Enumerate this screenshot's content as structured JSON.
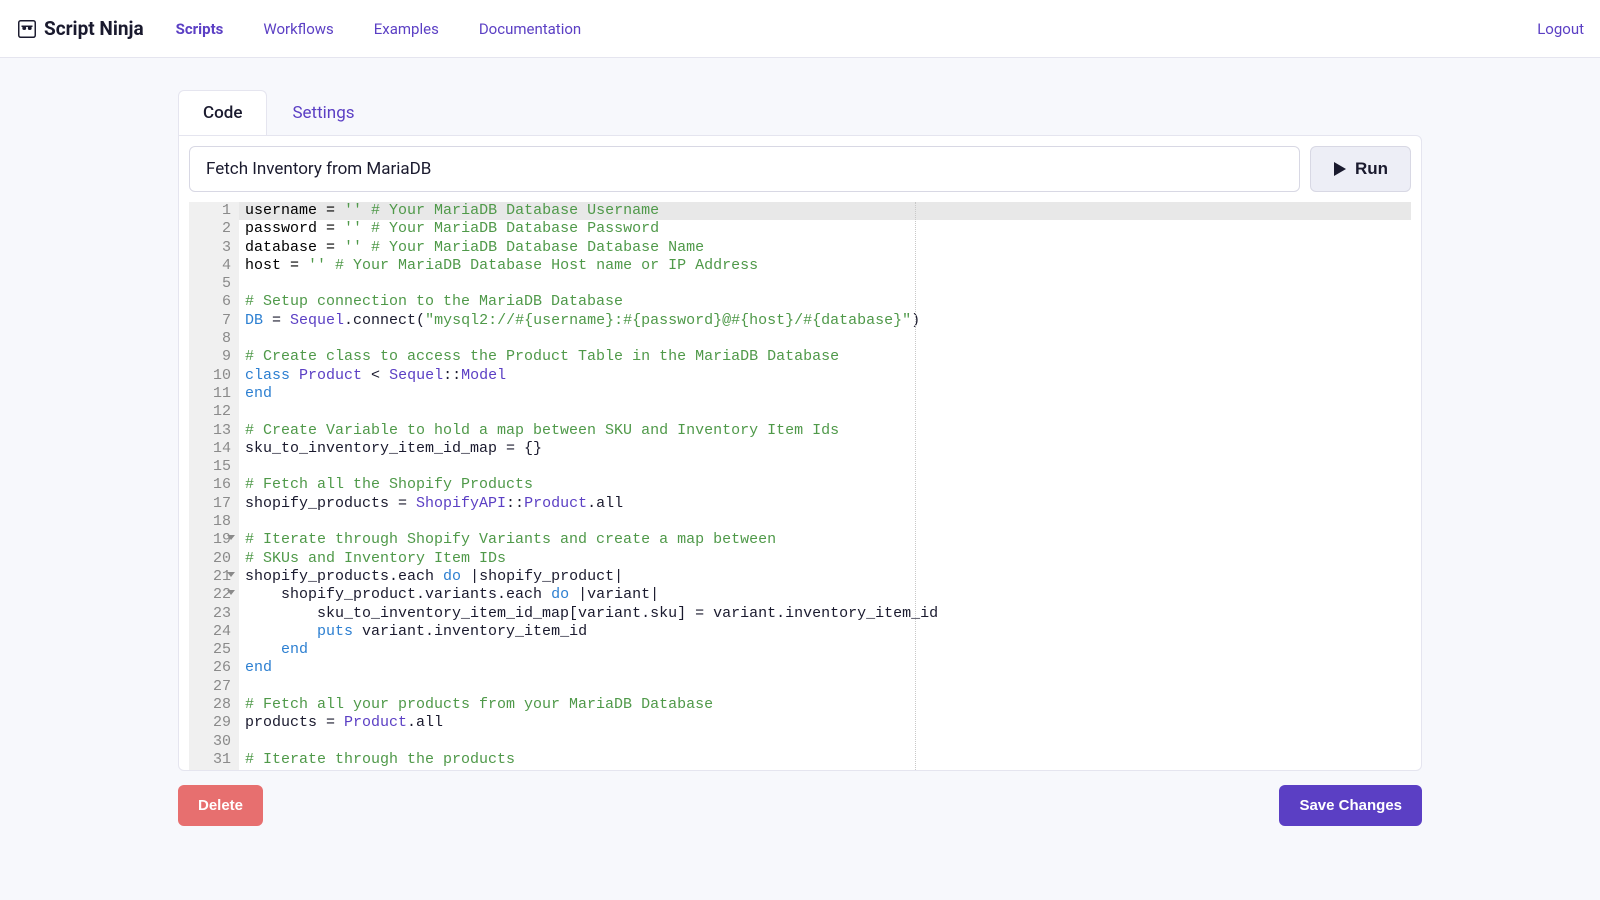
{
  "brand": "Script Ninja",
  "nav": {
    "scripts": "Scripts",
    "workflows": "Workflows",
    "examples": "Examples",
    "documentation": "Documentation",
    "logout": "Logout"
  },
  "tabs": {
    "code": "Code",
    "settings": "Settings"
  },
  "script_title": "Fetch Inventory from MariaDB",
  "run_label": "Run",
  "delete_label": "Delete",
  "save_label": "Save Changes",
  "code": {
    "l1": {
      "a": "username ",
      "b": "=",
      "c": " ''",
      "d": " # Your MariaDB Database Username"
    },
    "l2": {
      "a": "password ",
      "b": "=",
      "c": " ''",
      "d": " # Your MariaDB Database Password"
    },
    "l3": {
      "a": "database ",
      "b": "=",
      "c": " ''",
      "d": " # Your MariaDB Database Database Name"
    },
    "l4": {
      "a": "host ",
      "b": "=",
      "c": " ''",
      "d": " # Your MariaDB Database Host name or IP Address"
    },
    "l6": "# Setup connection to the MariaDB Database",
    "l7": {
      "a": "DB",
      "b": " = ",
      "c": "Sequel",
      "d": ".connect(",
      "e": "\"mysql2://#{username}:#{password}@#{host}/#{database}\"",
      "f": ")"
    },
    "l9": "# Create class to access the Product Table in the MariaDB Database",
    "l10": {
      "a": "class",
      "b": " ",
      "c": "Product",
      "d": " < ",
      "e": "Sequel",
      "f": "::",
      "g": "Model"
    },
    "l11": "end",
    "l13": "# Create Variable to hold a map between SKU and Inventory Item Ids",
    "l14": "sku_to_inventory_item_id_map = {}",
    "l16": "# Fetch all the Shopify Products",
    "l17": {
      "a": "shopify_products = ",
      "b": "ShopifyAPI",
      "c": "::",
      "d": "Product",
      "e": ".all"
    },
    "l19": "# Iterate through Shopify Variants and create a map between",
    "l20": "# SKUs and Inventory Item IDs",
    "l21": {
      "a": "shopify_products.each ",
      "b": "do",
      "c": " |shopify_product|"
    },
    "l22": {
      "a": "    shopify_product.variants.each ",
      "b": "do",
      "c": " |variant|"
    },
    "l23": "        sku_to_inventory_item_id_map[variant.sku] = variant.inventory_item_id",
    "l24": {
      "a": "        ",
      "b": "puts",
      "c": " variant.inventory_item_id"
    },
    "l25": {
      "a": "    ",
      "b": "end"
    },
    "l26": "end",
    "l28": "# Fetch all your products from your MariaDB Database",
    "l29": {
      "a": "products = ",
      "b": "Product",
      "c": ".all"
    },
    "l31": "# Iterate through the products"
  },
  "line_numbers": [
    "1",
    "2",
    "3",
    "4",
    "5",
    "6",
    "7",
    "8",
    "9",
    "10",
    "11",
    "12",
    "13",
    "14",
    "15",
    "16",
    "17",
    "18",
    "19",
    "20",
    "21",
    "22",
    "23",
    "24",
    "25",
    "26",
    "27",
    "28",
    "29",
    "30",
    "31"
  ],
  "fold_lines": [
    19,
    21,
    22
  ]
}
